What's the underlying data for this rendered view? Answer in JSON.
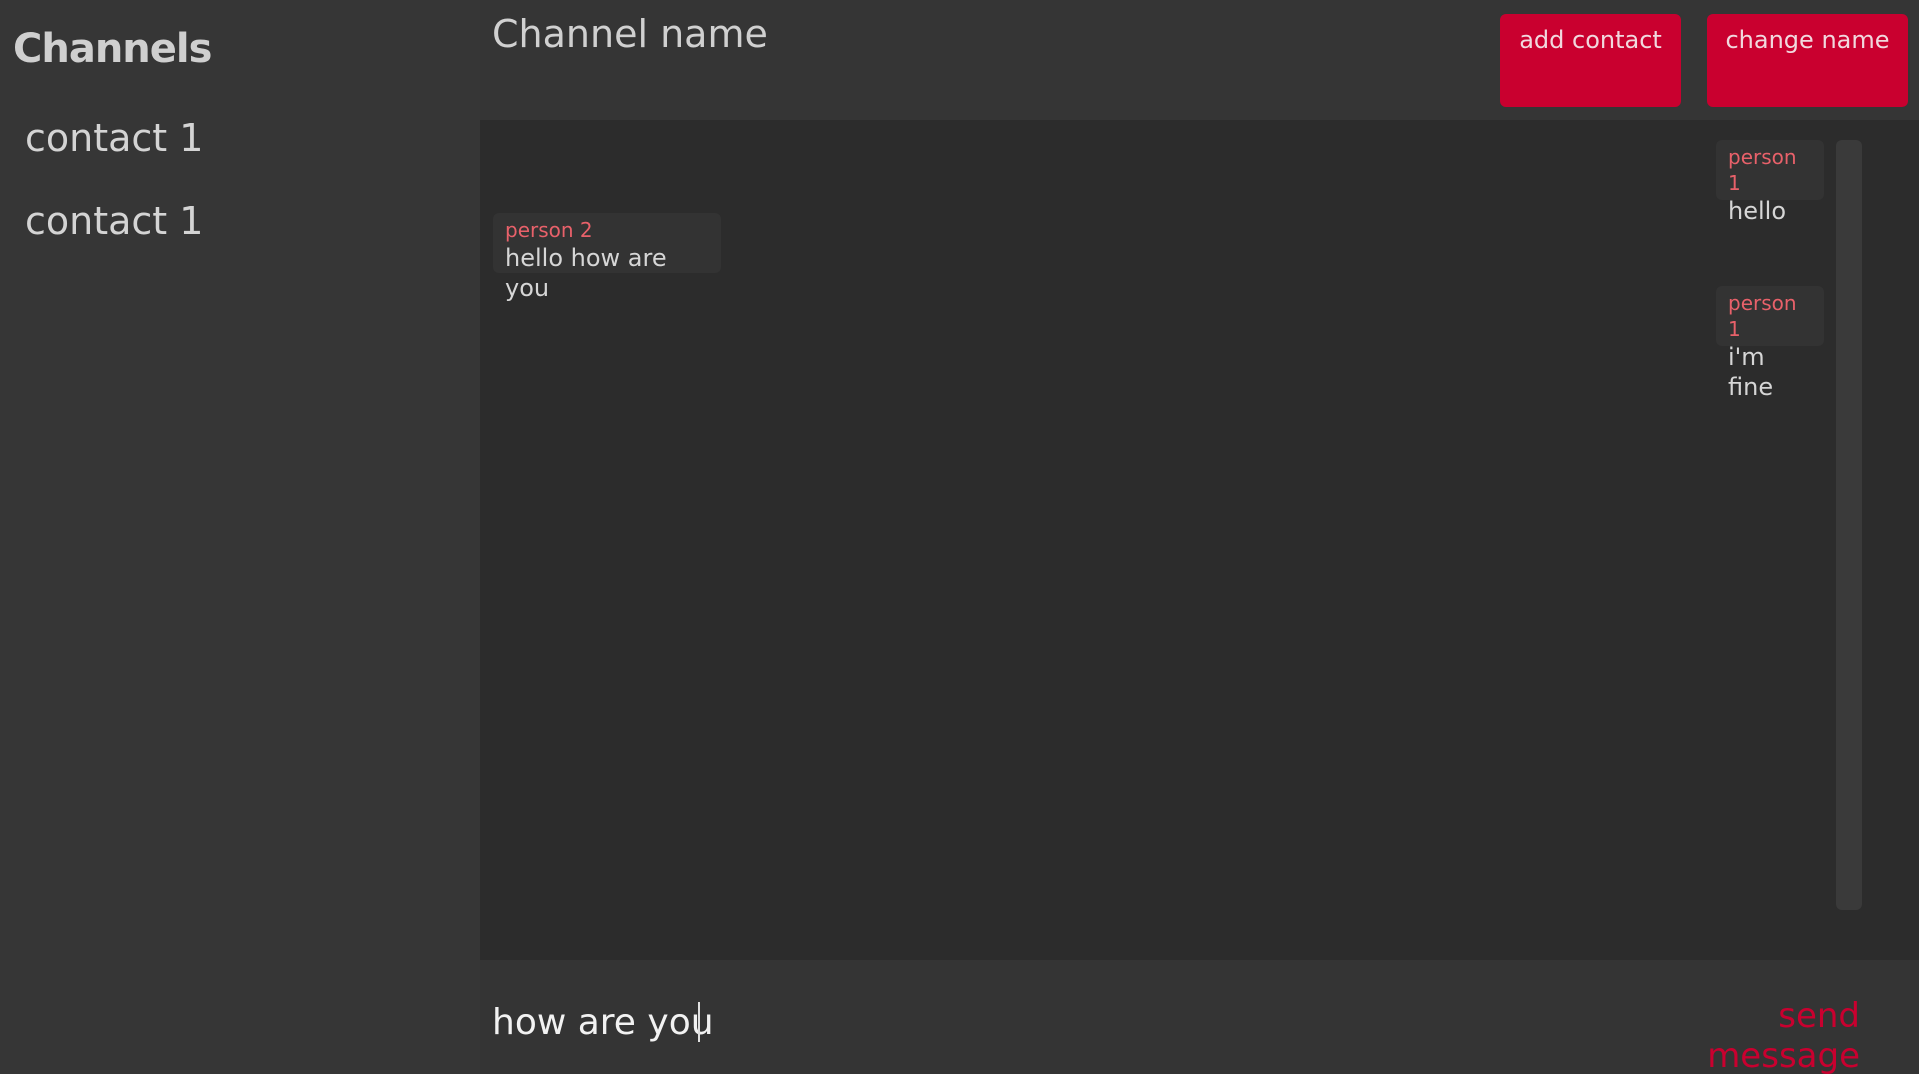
{
  "sidebar": {
    "title": "Channels",
    "items": [
      {
        "label": "contact 1"
      },
      {
        "label": "contact 1"
      }
    ]
  },
  "header": {
    "channel_name": "Channel name",
    "add_contact_label": "add contact",
    "change_name_label": "change name"
  },
  "messages": [
    {
      "author": "person 1",
      "text": "hello",
      "side": "right"
    },
    {
      "author": "person 2",
      "text": "hello how are you",
      "side": "left"
    },
    {
      "author": "person 1",
      "text": "i'm fine",
      "side": "right"
    }
  ],
  "composer": {
    "input_value": "how are you",
    "send_label": "send message"
  },
  "colors": {
    "accent": "#c9002f",
    "author": "#e8616a",
    "background": "#2c2c2c",
    "panel": "#353535"
  }
}
